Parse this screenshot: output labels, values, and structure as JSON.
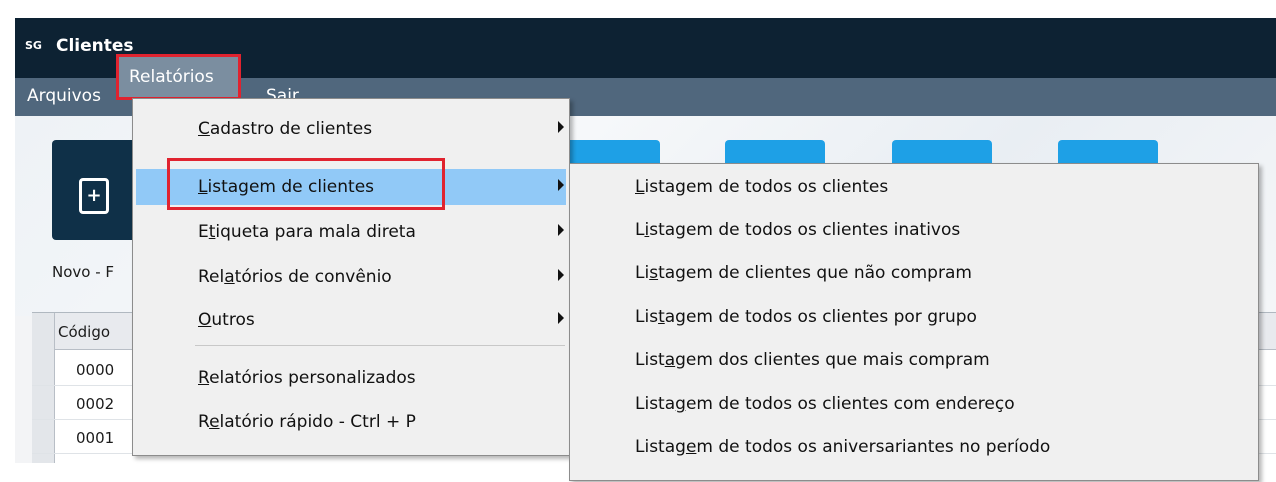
{
  "window": {
    "title": "Clientes",
    "logo": "SG"
  },
  "menubar": {
    "items": [
      "Arquivos",
      "Relatórios",
      "Sair"
    ],
    "selected": "Relatórios"
  },
  "toolbar": {
    "new_caption": "Novo - F"
  },
  "grid": {
    "header": "Código",
    "codes": [
      "0000",
      "0002",
      "0001"
    ]
  },
  "relatorios_menu": {
    "items": [
      {
        "pre": "",
        "ul": "C",
        "post": "adastro de clientes",
        "submenu": true
      },
      {
        "pre": "",
        "ul": "L",
        "post": "istagem de clientes",
        "submenu": true,
        "highlighted": true
      },
      {
        "pre": "E",
        "ul": "t",
        "post": "iqueta para mala direta",
        "submenu": true
      },
      {
        "pre": "Rel",
        "ul": "a",
        "post": "tórios de convênio",
        "submenu": true
      },
      {
        "pre": "",
        "ul": "O",
        "post": "utros",
        "submenu": true
      },
      {
        "pre": "",
        "ul": "R",
        "post": "elatórios personalizados",
        "submenu": false
      },
      {
        "pre": "R",
        "ul": "e",
        "post": "latório rápido - Ctrl + P",
        "submenu": false
      }
    ]
  },
  "listagem_submenu": {
    "items": [
      {
        "pre": "",
        "ul": "L",
        "post": "istagem de todos os clientes"
      },
      {
        "pre": "L",
        "ul": "i",
        "post": "stagem de todos os clientes inativos"
      },
      {
        "pre": "Li",
        "ul": "s",
        "post": "tagem de clientes que não compram"
      },
      {
        "pre": "Lis",
        "ul": "t",
        "post": "agem de todos os clientes por grupo"
      },
      {
        "pre": "List",
        "ul": "a",
        "post": "gem dos clientes que mais compram"
      },
      {
        "pre": "Lista",
        "ul": "g",
        "post": "em de todos os clientes com endereço"
      },
      {
        "pre": "Listag",
        "ul": "e",
        "post": "m de todos os aniversariantes no período"
      }
    ]
  },
  "colors": {
    "titlebar": "#0d2233",
    "menubar": "#50677d",
    "highlight": "#91c9f7",
    "annotation": "#e0232f"
  }
}
